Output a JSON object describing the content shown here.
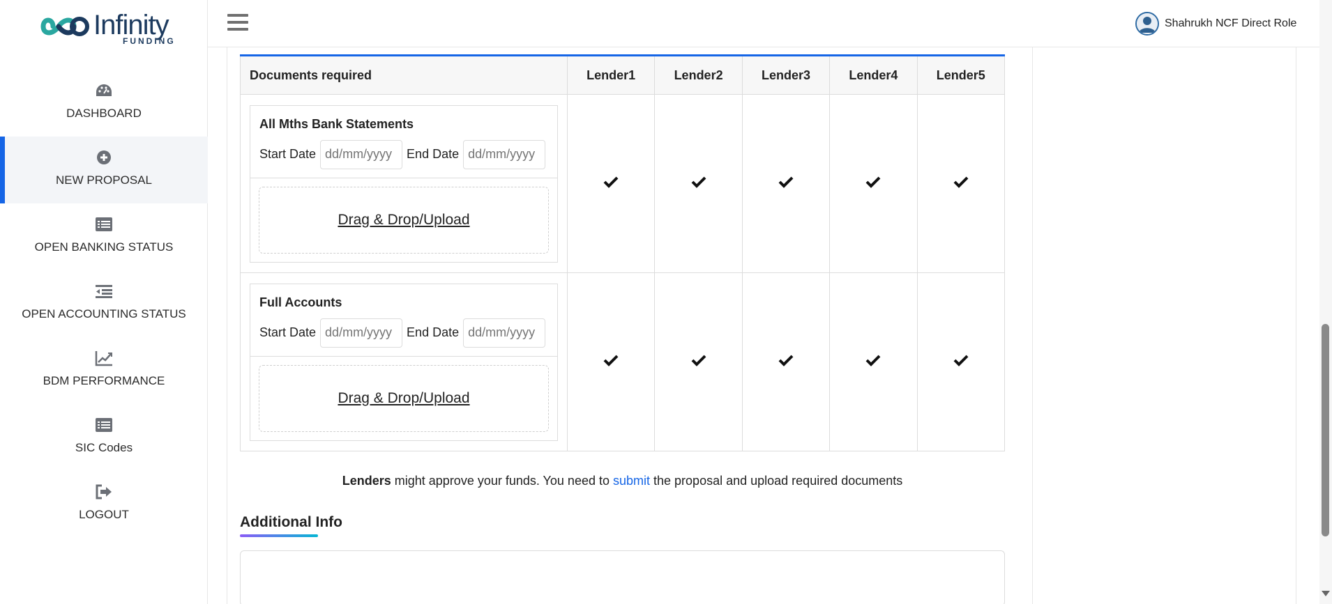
{
  "brand": {
    "name": "Infinity",
    "subtitle": "FUNDING"
  },
  "sidebar": {
    "items": [
      {
        "label": "DASHBOARD",
        "icon": "dashboard-icon"
      },
      {
        "label": "NEW PROPOSAL",
        "icon": "plus-circle-icon",
        "active": true
      },
      {
        "label": "OPEN BANKING STATUS",
        "icon": "list-icon"
      },
      {
        "label": "OPEN ACCOUNTING STATUS",
        "icon": "indent-icon"
      },
      {
        "label": "BDM PERFORMANCE",
        "icon": "chart-line-icon"
      },
      {
        "label": "SIC Codes",
        "icon": "list-icon"
      },
      {
        "label": "LOGOUT",
        "icon": "sign-out-icon"
      }
    ]
  },
  "header": {
    "user_name": "Shahrukh NCF Direct Role"
  },
  "table": {
    "headers": [
      "Documents required",
      "Lender1",
      "Lender2",
      "Lender3",
      "Lender4",
      "Lender5"
    ],
    "rows": [
      {
        "title": "All Mths Bank Statements",
        "start_label": "Start Date",
        "end_label": "End Date",
        "start_placeholder": "dd/mm/yyyy",
        "end_placeholder": "dd/mm/yyyy",
        "upload_label": "Drag & Drop/Upload",
        "checks": [
          true,
          true,
          true,
          true,
          true
        ]
      },
      {
        "title": "Full Accounts",
        "start_label": "Start Date",
        "end_label": "End Date",
        "start_placeholder": "dd/mm/yyyy",
        "end_placeholder": "dd/mm/yyyy",
        "upload_label": "Drag & Drop/Upload",
        "checks": [
          true,
          true,
          true,
          true,
          true
        ]
      }
    ]
  },
  "note": {
    "bold": "Lenders",
    "part1": " might approve your funds. You need to ",
    "link": "submit",
    "part2": " the proposal and upload required documents"
  },
  "additional_info": {
    "title": "Additional Info"
  },
  "colors": {
    "accent": "#1565e6",
    "gradient_start": "#8b5cf6",
    "gradient_end": "#06b6d4"
  }
}
